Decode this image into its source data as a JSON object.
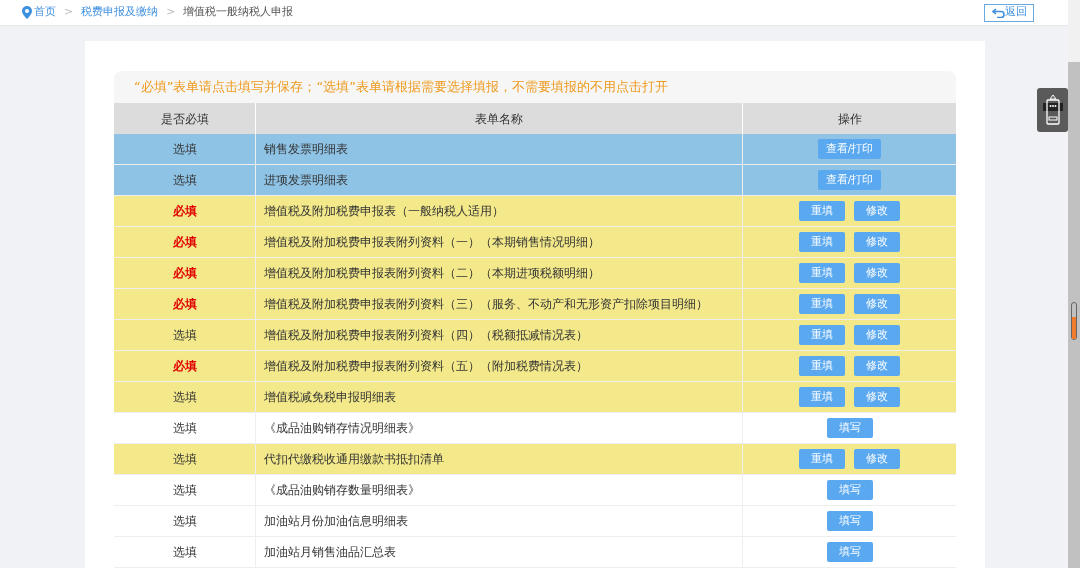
{
  "breadcrumb": [
    {
      "label": "首页",
      "link": true
    },
    {
      "label": "税费申报及缴纳",
      "link": true
    },
    {
      "label": "增值税一般纳税人申报",
      "link": false
    }
  ],
  "separator": ">",
  "back_button": "返回",
  "notice": "“必填”表单请点击填写并保存；“选填”表单请根据需要选择填报，不需要填报的不用点击打开",
  "table": {
    "columns": [
      "是否必填",
      "表单名称",
      "操作"
    ],
    "rows": [
      {
        "kind": "view",
        "required": false,
        "requirement": "选填",
        "name": "销售发票明细表",
        "actions": [
          "查看/打印"
        ]
      },
      {
        "kind": "view",
        "required": false,
        "requirement": "选填",
        "name": "进项发票明细表",
        "actions": [
          "查看/打印"
        ]
      },
      {
        "kind": "filled",
        "required": true,
        "requirement": "必填",
        "name": "增值税及附加税费申报表（一般纳税人适用）",
        "actions": [
          "重填",
          "修改"
        ]
      },
      {
        "kind": "filled",
        "required": true,
        "requirement": "必填",
        "name": "增值税及附加税费申报表附列资料（一）（本期销售情况明细）",
        "actions": [
          "重填",
          "修改"
        ]
      },
      {
        "kind": "filled",
        "required": true,
        "requirement": "必填",
        "name": "增值税及附加税费申报表附列资料（二）（本期进项税额明细）",
        "actions": [
          "重填",
          "修改"
        ]
      },
      {
        "kind": "filled",
        "required": true,
        "requirement": "必填",
        "name": "增值税及附加税费申报表附列资料（三）（服务、不动产和无形资产扣除项目明细）",
        "actions": [
          "重填",
          "修改"
        ]
      },
      {
        "kind": "filled",
        "required": false,
        "requirement": "选填",
        "name": "增值税及附加税费申报表附列资料（四）（税额抵减情况表）",
        "actions": [
          "重填",
          "修改"
        ]
      },
      {
        "kind": "filled",
        "required": true,
        "requirement": "必填",
        "name": "增值税及附加税费申报表附列资料（五）（附加税费情况表）",
        "actions": [
          "重填",
          "修改"
        ]
      },
      {
        "kind": "filled",
        "required": false,
        "requirement": "选填",
        "name": "增值税减免税申报明细表",
        "actions": [
          "重填",
          "修改"
        ]
      },
      {
        "kind": "blank",
        "required": false,
        "requirement": "选填",
        "name": "《成品油购销存情况明细表》",
        "actions": [
          "填写"
        ]
      },
      {
        "kind": "filled",
        "required": false,
        "requirement": "选填",
        "name": "代扣代缴税收通用缴款书抵扣清单",
        "actions": [
          "重填",
          "修改"
        ]
      },
      {
        "kind": "blank",
        "required": false,
        "requirement": "选填",
        "name": "《成品油购销存数量明细表》",
        "actions": [
          "填写"
        ]
      },
      {
        "kind": "blank",
        "required": false,
        "requirement": "选填",
        "name": "加油站月份加油信息明细表",
        "actions": [
          "填写"
        ]
      },
      {
        "kind": "blank",
        "required": false,
        "requirement": "选填",
        "name": "加油站月销售油品汇总表",
        "actions": [
          "填写"
        ]
      }
    ]
  }
}
